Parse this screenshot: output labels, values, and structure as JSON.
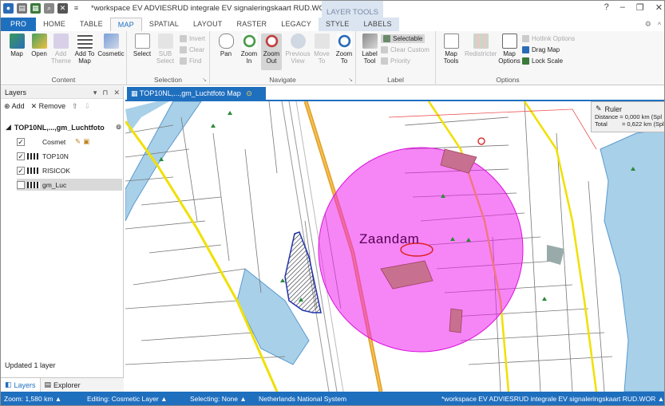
{
  "window": {
    "title": "*workspace EV ADVIESRUD integrale EV signaleringskaart RUD.WOR - MapInfo Pro",
    "context_tab_group": "LAYER TOOLS",
    "controls": [
      "?",
      "–",
      "❐",
      "✕"
    ]
  },
  "ribbon_tabs": [
    {
      "label": "PRO"
    },
    {
      "label": "HOME"
    },
    {
      "label": "TABLE"
    },
    {
      "label": "MAP"
    },
    {
      "label": "SPATIAL"
    },
    {
      "label": "LAYOUT"
    },
    {
      "label": "RASTER"
    },
    {
      "label": "LEGACY"
    },
    {
      "label": "STYLE"
    },
    {
      "label": "LABELS"
    }
  ],
  "ribbon": {
    "content": {
      "label": "Content",
      "map": "Map",
      "open": "Open",
      "add_theme": "Add\nTheme",
      "add_to_map": "Add To\nMap",
      "cosmetic": "Cosmetic"
    },
    "selection": {
      "label": "Selection",
      "select": "Select",
      "sub_select": "SUB\nSelect",
      "invert": "Invert",
      "clear": "Clear",
      "find": "Find"
    },
    "navigate": {
      "label": "Navigate",
      "pan": "Pan",
      "zoom_in": "Zoom\nIn",
      "zoom_out": "Zoom\nOut",
      "previous_view": "Previous\nView",
      "move_to": "Move\nTo",
      "zoom_to": "Zoom\nTo"
    },
    "label_grp": {
      "label": "Label",
      "label_tool": "Label\nTool",
      "selectable": "Selectable",
      "clear_custom": "Clear Custom",
      "priority": "Priority"
    },
    "options": {
      "label": "Options",
      "map_tools": "Map\nTools",
      "redistricter": "Redistricter",
      "map_options": "Map\nOptions",
      "hotlink_options": "Hotlink Options",
      "drag_map": "Drag Map",
      "lock_scale": "Lock Scale"
    }
  },
  "layers_panel": {
    "title": "Layers",
    "add": "Add",
    "remove": "Remove",
    "root": "TOP10NL,...,gm_Luchtfoto",
    "rows": [
      {
        "name": "Cosmet",
        "checked": true
      },
      {
        "name": "TOP10N",
        "checked": true
      },
      {
        "name": "RISICOK",
        "checked": true
      },
      {
        "name": "gm_Luc",
        "checked": false
      }
    ],
    "status": "Updated 1 layer",
    "tabs": [
      "Layers",
      "Explorer"
    ]
  },
  "map": {
    "tab_title": "TOP10NL,...,gm_Luchtfoto Map",
    "place_label": "Zaandam",
    "ruler": {
      "title": "Ruler",
      "distance_label": "Distance",
      "distance": "= 0,000 km (Spl",
      "total_label": "Total",
      "total": "= 0,622 km (Spl"
    }
  },
  "statusbar": {
    "zoom": "Zoom: 1,580 km",
    "editing": "Editing: Cosmetic Layer",
    "selecting": "Selecting: None",
    "projection": "Netherlands National System",
    "workspace": "*workspace EV ADVIESRUD integrale EV signaleringskaart RUD.WOR"
  },
  "colors": {
    "accent": "#1f6fbf",
    "buffer": "#ee22ee",
    "rail": "#e0a020",
    "water": "#a8d0e8"
  }
}
